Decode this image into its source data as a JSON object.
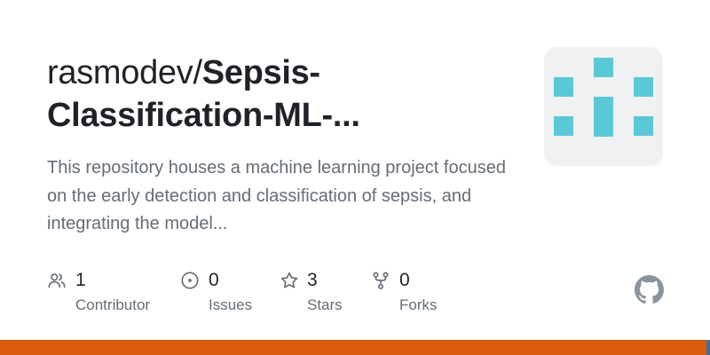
{
  "repo": {
    "owner": "rasmodev/",
    "name_line1": "Sepsis-",
    "name_line2": "Classification-ML-...",
    "description": "This repository houses a machine learning project focused on the early detection and classification of sepsis, and integrating the model..."
  },
  "stats": [
    {
      "icon": "contributors-icon",
      "value": "1",
      "label": "Contributor"
    },
    {
      "icon": "issues-icon",
      "value": "0",
      "label": "Issues"
    },
    {
      "icon": "star-icon",
      "value": "3",
      "label": "Stars"
    },
    {
      "icon": "fork-icon",
      "value": "0",
      "label": "Forks"
    }
  ],
  "colors": {
    "title": "#1f2328",
    "muted": "#656d76",
    "avatar_tile": "#5bc9d5",
    "avatar_bg": "#f0f1f2",
    "language_primary": "#da5b0b"
  },
  "language_bar": [
    {
      "color": "#da5b0b",
      "share": 0.995
    },
    {
      "color": "#3572a5",
      "share": 0.005
    }
  ]
}
